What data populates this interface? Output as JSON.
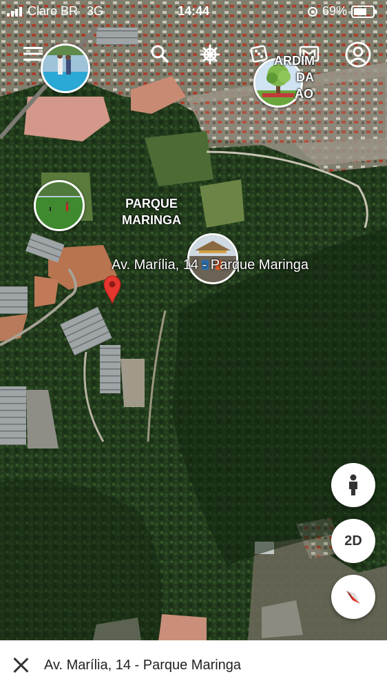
{
  "status": {
    "carrier": "Claro BR",
    "network": "3G",
    "time": "14:44",
    "battery": "69%"
  },
  "toolbar": {
    "menu_icon": "menu-icon",
    "search_icon": "search-icon",
    "voyager_icon": "ship-wheel-icon",
    "dice_icon": "dice-icon",
    "projects_icon": "projects-icon",
    "account_icon": "account-icon"
  },
  "map": {
    "labels": {
      "parque": "PARQUE",
      "maringa": "MARINGA",
      "address": "Av. Marília, 14 - Parque Maringa",
      "jardim_a": "ARDIM",
      "jardim_b": "DA",
      "jardim_c": "AO"
    }
  },
  "controls": {
    "pegman_icon": "pegman-icon",
    "view_mode": "2D",
    "compass_icon": "compass-icon"
  },
  "bottom_sheet": {
    "title": "Av. Marília, 14 - Parque Maringa",
    "close_icon": "close-icon"
  }
}
